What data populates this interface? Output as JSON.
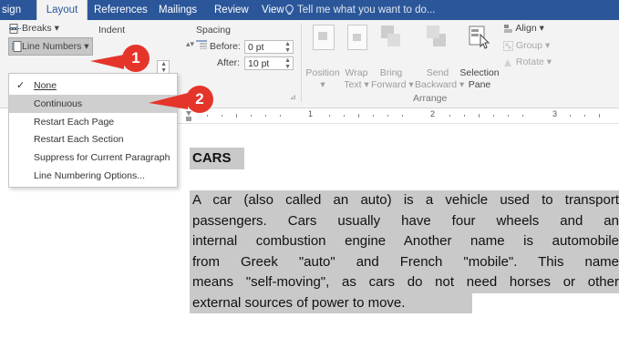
{
  "tabs": [
    {
      "label": "sign"
    },
    {
      "label": "Layout"
    },
    {
      "label": "References"
    },
    {
      "label": "Mailings"
    },
    {
      "label": "Review"
    },
    {
      "label": "View"
    }
  ],
  "tell_me_placeholder": "Tell me what you want to do...",
  "ribbon": {
    "breaks_label": "Breaks",
    "line_numbers_label": "Line Numbers",
    "indent_label": "Indent",
    "spacing_label": "Spacing",
    "before_label": "Before:",
    "before_value": "0 pt",
    "after_label": "After:",
    "after_value": "10 pt",
    "position_label": "Position",
    "wrap_text_label": [
      "Wrap",
      "Text"
    ],
    "bring_forward_label": [
      "Bring",
      "Forward"
    ],
    "send_backward_label": [
      "Send",
      "Backward"
    ],
    "selection_pane_label": [
      "Selection",
      "Pane"
    ],
    "align_label": "Align",
    "group_label": "Group",
    "rotate_label": "Rotate",
    "arrange_group_label": "Arrange"
  },
  "line_numbers_menu": {
    "items": [
      {
        "label": "None",
        "checked": true
      },
      {
        "label": "Continuous",
        "highlighted": true
      },
      {
        "label": "Restart Each Page"
      },
      {
        "label": "Restart Each Section"
      },
      {
        "label": "Suppress for Current Paragraph"
      },
      {
        "label": "Line Numbering Options..."
      }
    ]
  },
  "callouts": [
    "1",
    "2"
  ],
  "ruler_numbers": [
    "1",
    "2",
    "3"
  ],
  "document": {
    "title": "CARS",
    "paragraph_lines": [
      "A car (also called an auto) is a vehicle used to transport",
      "passengers. Cars usually have four wheels and an",
      "internal combustion engine Another name is automobile",
      "from Greek \"auto\" and French \"mobile\". This name",
      "means \"self-moving\", as cars do not need horses or other",
      "external sources of power to move."
    ]
  },
  "colors": {
    "tab_bar": "#2b579a",
    "ribbon_bg": "#f3f3f3",
    "callout": "#e5352b",
    "highlight": "#c9c9c9"
  }
}
